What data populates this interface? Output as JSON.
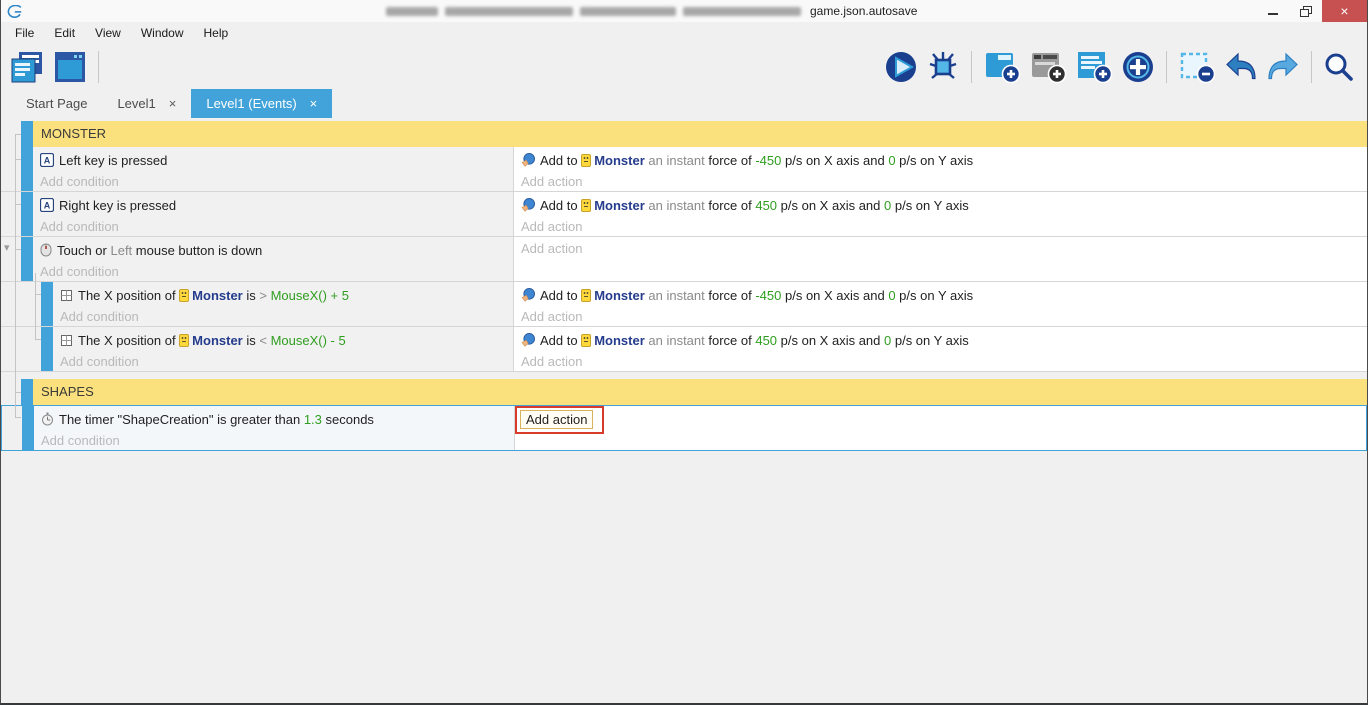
{
  "window": {
    "title_visible": "game.json.autosave",
    "buttons": [
      "minimize",
      "restore",
      "close"
    ]
  },
  "menu": {
    "items": [
      "File",
      "Edit",
      "View",
      "Window",
      "Help"
    ]
  },
  "toolbar": {
    "left_icons": [
      "project-manager-icon",
      "scene-editor-icon"
    ],
    "right_icons": [
      "play-icon",
      "debug-icon",
      "add-event-icon",
      "add-subevent-icon",
      "add-comment-icon",
      "add-other-icon",
      "delete-event-icon",
      "undo-icon",
      "redo-icon",
      "search-icon"
    ]
  },
  "tabs": [
    {
      "label": "Start Page",
      "closable": false,
      "active": false,
      "close_glyph": ""
    },
    {
      "label": "Level1",
      "closable": true,
      "active": false,
      "close_glyph": "×"
    },
    {
      "label": "Level1 (Events)",
      "closable": true,
      "active": true,
      "close_glyph": "×"
    }
  ],
  "colors": {
    "accent_blue": "#42a3da",
    "group_yellow": "#fbe17e",
    "value_green": "#2f9e1f",
    "object_navy": "#253c8d",
    "close_red": "#c75050",
    "annotation_red": "#d93b2b"
  },
  "events": [
    {
      "type": "group",
      "label": "MONSTER"
    },
    {
      "type": "event",
      "conditions": [
        {
          "icon": "keyboard-icon",
          "segments": [
            {
              "t": "Left key is pressed",
              "c": "text"
            }
          ]
        }
      ],
      "add_condition": "Add condition",
      "actions": [
        {
          "icon": "force-icon",
          "segments": [
            {
              "t": "Add to ",
              "c": "text"
            },
            {
              "t": "Monster",
              "c": "object",
              "icon": "monster-icon"
            },
            {
              "t": " an instant ",
              "c": "muted"
            },
            {
              "t": "force of ",
              "c": "text"
            },
            {
              "t": "-450",
              "c": "green"
            },
            {
              "t": " p/s on X axis and ",
              "c": "text"
            },
            {
              "t": "0",
              "c": "green"
            },
            {
              "t": " p/s on Y axis",
              "c": "text"
            }
          ]
        }
      ],
      "add_action": "Add action"
    },
    {
      "type": "event",
      "conditions": [
        {
          "icon": "keyboard-icon",
          "segments": [
            {
              "t": "Right key is pressed",
              "c": "text"
            }
          ]
        }
      ],
      "add_condition": "Add condition",
      "actions": [
        {
          "icon": "force-icon",
          "segments": [
            {
              "t": "Add to ",
              "c": "text"
            },
            {
              "t": "Monster",
              "c": "object",
              "icon": "monster-icon"
            },
            {
              "t": " an instant ",
              "c": "muted"
            },
            {
              "t": "force of ",
              "c": "text"
            },
            {
              "t": "450",
              "c": "green"
            },
            {
              "t": " p/s on X axis and ",
              "c": "text"
            },
            {
              "t": "0",
              "c": "green"
            },
            {
              "t": " p/s on Y axis",
              "c": "text"
            }
          ]
        }
      ],
      "add_action": "Add action"
    },
    {
      "type": "event",
      "collapse_arrow": true,
      "conditions": [
        {
          "icon": "mouse-icon",
          "segments": [
            {
              "t": "Touch or ",
              "c": "text"
            },
            {
              "t": "Left",
              "c": "muted"
            },
            {
              "t": " mouse button is down",
              "c": "text"
            }
          ]
        }
      ],
      "add_condition": "Add condition",
      "actions": [],
      "add_action": "Add action"
    },
    {
      "type": "event",
      "sub": true,
      "conditions": [
        {
          "icon": "position-icon",
          "segments": [
            {
              "t": "The X position of ",
              "c": "text"
            },
            {
              "t": "Monster",
              "c": "object",
              "icon": "monster-icon"
            },
            {
              "t": " is ",
              "c": "text"
            },
            {
              "t": "> ",
              "c": "muted"
            },
            {
              "t": "MouseX() + 5",
              "c": "green"
            }
          ]
        }
      ],
      "add_condition": "Add condition",
      "actions": [
        {
          "icon": "force-icon",
          "segments": [
            {
              "t": "Add to ",
              "c": "text"
            },
            {
              "t": "Monster",
              "c": "object",
              "icon": "monster-icon"
            },
            {
              "t": " an instant ",
              "c": "muted"
            },
            {
              "t": "force of ",
              "c": "text"
            },
            {
              "t": "-450",
              "c": "green"
            },
            {
              "t": " p/s on X axis and ",
              "c": "text"
            },
            {
              "t": "0",
              "c": "green"
            },
            {
              "t": " p/s on Y axis",
              "c": "text"
            }
          ]
        }
      ],
      "add_action": "Add action"
    },
    {
      "type": "event",
      "sub": true,
      "conditions": [
        {
          "icon": "position-icon",
          "segments": [
            {
              "t": "The X position of ",
              "c": "text"
            },
            {
              "t": "Monster",
              "c": "object",
              "icon": "monster-icon"
            },
            {
              "t": " is ",
              "c": "text"
            },
            {
              "t": "< ",
              "c": "muted"
            },
            {
              "t": "MouseX() - 5",
              "c": "green"
            }
          ]
        }
      ],
      "add_condition": "Add condition",
      "actions": [
        {
          "icon": "force-icon",
          "segments": [
            {
              "t": "Add to ",
              "c": "text"
            },
            {
              "t": "Monster",
              "c": "object",
              "icon": "monster-icon"
            },
            {
              "t": " an instant ",
              "c": "muted"
            },
            {
              "t": "force of ",
              "c": "text"
            },
            {
              "t": "450",
              "c": "green"
            },
            {
              "t": " p/s on X axis and ",
              "c": "text"
            },
            {
              "t": "0",
              "c": "green"
            },
            {
              "t": " p/s on Y axis",
              "c": "text"
            }
          ]
        }
      ],
      "add_action": "Add action"
    },
    {
      "type": "group",
      "label": "SHAPES",
      "gap_before": true
    },
    {
      "type": "event",
      "selected": true,
      "annotated": true,
      "add_action_focused": true,
      "conditions": [
        {
          "icon": "timer-icon",
          "segments": [
            {
              "t": "The timer \"ShapeCreation\" is greater than ",
              "c": "text"
            },
            {
              "t": "1.3",
              "c": "green"
            },
            {
              "t": " seconds",
              "c": "text"
            }
          ]
        }
      ],
      "add_condition": "Add condition",
      "actions": [],
      "add_action": "Add action"
    }
  ]
}
